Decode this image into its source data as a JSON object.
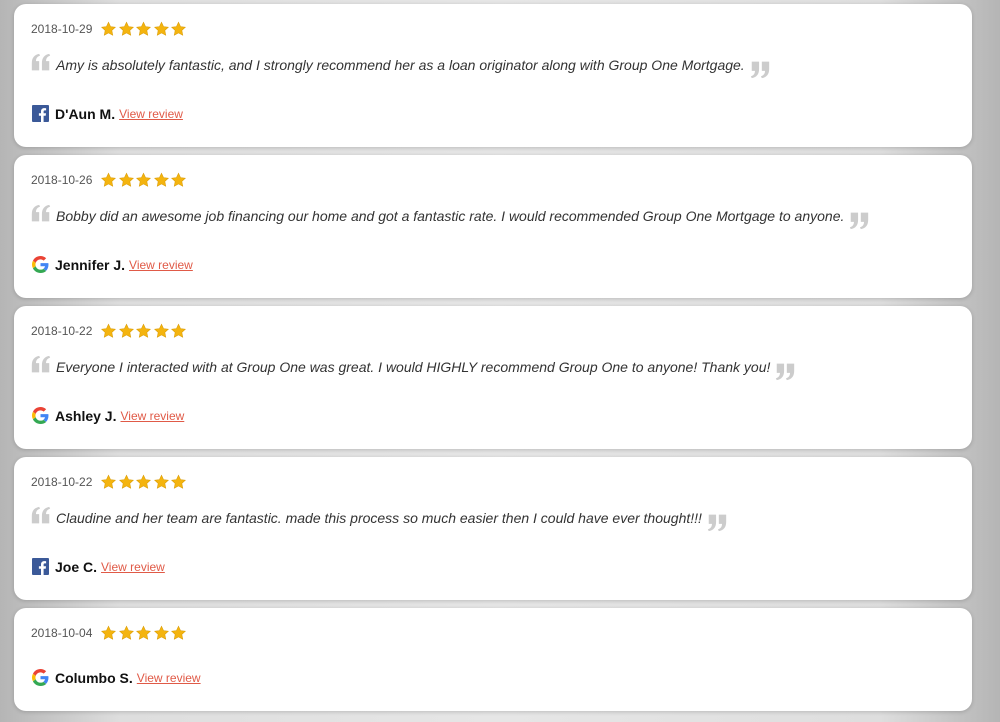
{
  "reviews": [
    {
      "date": "2018-10-29",
      "rating": 5,
      "text": "Amy is absolutely fantastic, and I strongly recommend her as a loan originator along with Group One Mortgage.",
      "author": "D'Aun M.",
      "source": "facebook-icon",
      "link_label": "View review"
    },
    {
      "date": "2018-10-26",
      "rating": 5,
      "text": "Bobby did an awesome job financing our home and got a fantastic rate. I would recommended Group One Mortgage to anyone.",
      "author": "Jennifer J.",
      "source": "google-icon",
      "link_label": "View review"
    },
    {
      "date": "2018-10-22",
      "rating": 5,
      "text": "Everyone I interacted with at Group One was great. I would HIGHLY recommend Group One to anyone! Thank you!",
      "author": "Ashley J.",
      "source": "google-icon",
      "link_label": "View review"
    },
    {
      "date": "2018-10-22",
      "rating": 5,
      "text": "Claudine and her team are fantastic. made this process so much easier then I could have ever thought!!!",
      "author": "Joe C.",
      "source": "facebook-icon",
      "link_label": "View review"
    },
    {
      "date": "2018-10-04",
      "rating": 5,
      "text": "",
      "author": "Columbo S.",
      "source": "google-icon",
      "link_label": "View review"
    }
  ],
  "colors": {
    "star": "#f4b40f",
    "link": "#e05a47",
    "facebook": "#3b5998",
    "quote": "#cccccc"
  }
}
